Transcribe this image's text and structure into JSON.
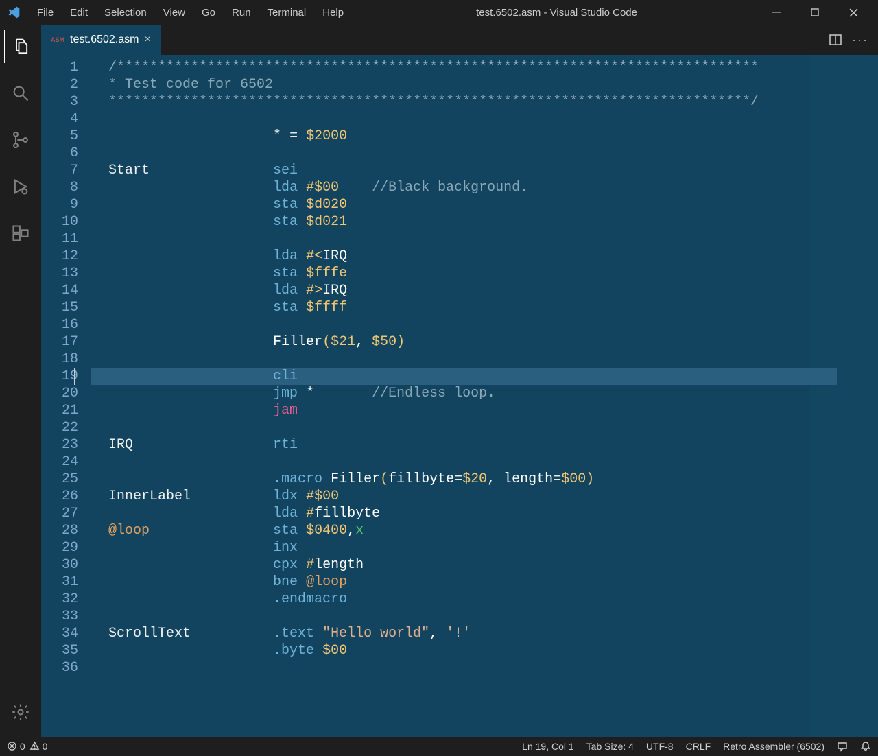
{
  "window": {
    "title": "test.6502.asm - Visual Studio Code"
  },
  "menubar": [
    "File",
    "Edit",
    "Selection",
    "View",
    "Go",
    "Run",
    "Terminal",
    "Help"
  ],
  "tab": {
    "badge": "ASM",
    "filename": "test.6502.asm"
  },
  "code": {
    "line_start": 1,
    "highlighted_line": 19,
    "lines": [
      [
        [
          "/******************************************************************************",
          "tok-comment"
        ]
      ],
      [
        [
          "* Test code for 6502",
          "tok-comment"
        ]
      ],
      [
        [
          "******************************************************************************/",
          "tok-comment"
        ]
      ],
      [],
      [
        [
          "                    ",
          "tok-label"
        ],
        [
          "*",
          "tok-oper"
        ],
        [
          " ",
          "tok-label"
        ],
        [
          "=",
          "tok-oper"
        ],
        [
          " ",
          "tok-label"
        ],
        [
          "$2000",
          "tok-number"
        ]
      ],
      [],
      [
        [
          "Start               ",
          "tok-label"
        ],
        [
          "sei",
          "tok-opcode"
        ]
      ],
      [
        [
          "                    ",
          "tok-label"
        ],
        [
          "lda",
          "tok-opcode"
        ],
        [
          " ",
          "tok-label"
        ],
        [
          "#",
          "tok-symbol"
        ],
        [
          "$00",
          "tok-number"
        ],
        [
          "    ",
          "tok-label"
        ],
        [
          "//Black background.",
          "tok-comment"
        ]
      ],
      [
        [
          "                    ",
          "tok-label"
        ],
        [
          "sta",
          "tok-opcode"
        ],
        [
          " ",
          "tok-label"
        ],
        [
          "$d020",
          "tok-number"
        ]
      ],
      [
        [
          "                    ",
          "tok-label"
        ],
        [
          "sta",
          "tok-opcode"
        ],
        [
          " ",
          "tok-label"
        ],
        [
          "$d021",
          "tok-number"
        ]
      ],
      [],
      [
        [
          "                    ",
          "tok-label"
        ],
        [
          "lda",
          "tok-opcode"
        ],
        [
          " ",
          "tok-label"
        ],
        [
          "#<",
          "tok-symbol"
        ],
        [
          "IRQ",
          "tok-white"
        ]
      ],
      [
        [
          "                    ",
          "tok-label"
        ],
        [
          "sta",
          "tok-opcode"
        ],
        [
          " ",
          "tok-label"
        ],
        [
          "$fffe",
          "tok-number"
        ]
      ],
      [
        [
          "                    ",
          "tok-label"
        ],
        [
          "lda",
          "tok-opcode"
        ],
        [
          " ",
          "tok-label"
        ],
        [
          "#>",
          "tok-symbol"
        ],
        [
          "IRQ",
          "tok-white"
        ]
      ],
      [
        [
          "                    ",
          "tok-label"
        ],
        [
          "sta",
          "tok-opcode"
        ],
        [
          " ",
          "tok-label"
        ],
        [
          "$ffff",
          "tok-number"
        ]
      ],
      [],
      [
        [
          "                    ",
          "tok-label"
        ],
        [
          "Filler",
          "tok-white"
        ],
        [
          "(",
          "tok-paren"
        ],
        [
          "$21",
          "tok-number"
        ],
        [
          ", ",
          "tok-white"
        ],
        [
          "$50",
          "tok-number"
        ],
        [
          ")",
          "tok-paren"
        ]
      ],
      [],
      [
        [
          "                    ",
          "tok-label"
        ],
        [
          "cli",
          "tok-opcode"
        ]
      ],
      [
        [
          "                    ",
          "tok-label"
        ],
        [
          "jmp",
          "tok-opcode"
        ],
        [
          " ",
          "tok-label"
        ],
        [
          "*",
          "tok-oper"
        ],
        [
          "       ",
          "tok-label"
        ],
        [
          "//Endless loop.",
          "tok-comment"
        ]
      ],
      [
        [
          "                    ",
          "tok-label"
        ],
        [
          "jam",
          "tok-opcode-jam"
        ]
      ],
      [],
      [
        [
          "IRQ                 ",
          "tok-label"
        ],
        [
          "rti",
          "tok-opcode"
        ]
      ],
      [],
      [
        [
          "                    ",
          "tok-label"
        ],
        [
          ".macro",
          "tok-directive"
        ],
        [
          " ",
          "tok-label"
        ],
        [
          "Filler",
          "tok-white"
        ],
        [
          "(",
          "tok-paren"
        ],
        [
          "fillbyte",
          "tok-white"
        ],
        [
          "=",
          "tok-oper"
        ],
        [
          "$20",
          "tok-number"
        ],
        [
          ", ",
          "tok-white"
        ],
        [
          "length",
          "tok-white"
        ],
        [
          "=",
          "tok-oper"
        ],
        [
          "$00",
          "tok-number"
        ],
        [
          ")",
          "tok-paren"
        ]
      ],
      [
        [
          "InnerLabel          ",
          "tok-label"
        ],
        [
          "ldx",
          "tok-opcode"
        ],
        [
          " ",
          "tok-label"
        ],
        [
          "#",
          "tok-symbol"
        ],
        [
          "$00",
          "tok-number"
        ]
      ],
      [
        [
          "                    ",
          "tok-label"
        ],
        [
          "lda",
          "tok-opcode"
        ],
        [
          " ",
          "tok-label"
        ],
        [
          "#",
          "tok-symbol"
        ],
        [
          "fillbyte",
          "tok-white"
        ]
      ],
      [
        [
          "@loop",
          "tok-atlabel"
        ],
        [
          "               ",
          "tok-label"
        ],
        [
          "sta",
          "tok-opcode"
        ],
        [
          " ",
          "tok-label"
        ],
        [
          "$0400",
          "tok-number"
        ],
        [
          ",",
          "tok-white"
        ],
        [
          "x",
          "tok-reg"
        ]
      ],
      [
        [
          "                    ",
          "tok-label"
        ],
        [
          "inx",
          "tok-opcode"
        ]
      ],
      [
        [
          "                    ",
          "tok-label"
        ],
        [
          "cpx",
          "tok-opcode"
        ],
        [
          " ",
          "tok-label"
        ],
        [
          "#",
          "tok-symbol"
        ],
        [
          "length",
          "tok-white"
        ]
      ],
      [
        [
          "                    ",
          "tok-label"
        ],
        [
          "bne",
          "tok-opcode"
        ],
        [
          " ",
          "tok-label"
        ],
        [
          "@loop",
          "tok-atlabel"
        ]
      ],
      [
        [
          "                    ",
          "tok-label"
        ],
        [
          ".endmacro",
          "tok-directive"
        ]
      ],
      [],
      [
        [
          "ScrollText          ",
          "tok-label"
        ],
        [
          ".text",
          "tok-directive"
        ],
        [
          " ",
          "tok-label"
        ],
        [
          "\"Hello world\"",
          "tok-string"
        ],
        [
          ", ",
          "tok-white"
        ],
        [
          "'!'",
          "tok-string"
        ]
      ],
      [
        [
          "                    ",
          "tok-label"
        ],
        [
          ".byte",
          "tok-directive"
        ],
        [
          " ",
          "tok-label"
        ],
        [
          "$00",
          "tok-number"
        ]
      ],
      []
    ]
  },
  "statusbar": {
    "errors": "0",
    "warnings": "0",
    "cursor": "Ln 19, Col 1",
    "tabsize": "Tab Size: 4",
    "encoding": "UTF-8",
    "eol": "CRLF",
    "language": "Retro Assembler (6502)"
  }
}
